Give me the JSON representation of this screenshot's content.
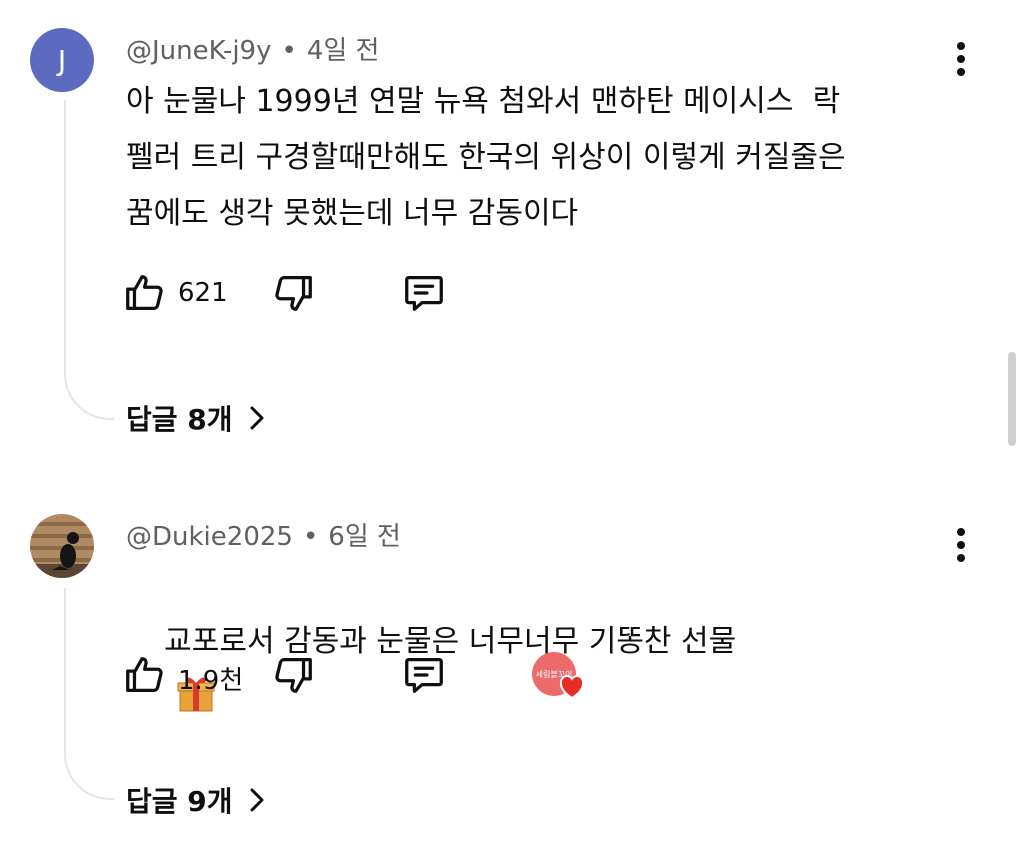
{
  "comments": [
    {
      "avatar_letter": "J",
      "author": "@JuneK-j9y",
      "time": "4일 전",
      "text": "아 눈물나 1999년 연말 뉴욕 첨와서 맨하탄 메이시스  락\n펠러 트리 구경할때만해도 한국의 위상이 이렇게 커질줄은\n꿈에도 생각 못했는데 너무 감동이다",
      "like_count": "621",
      "replies_label": "답글 8개"
    },
    {
      "author": "@Dukie2025",
      "time": "6일 전",
      "text": "교포로서 감동과 눈물은 너무너무 기똥찬 선물",
      "like_count": "1.9천",
      "creator_avatar_text": "세림볼꼬이",
      "replies_label": "답글 9개"
    }
  ],
  "separator_dot": "•",
  "icons": {
    "like": "thumbs-up-icon",
    "dislike": "thumbs-down-icon",
    "reply": "reply-comment-icon",
    "more": "more-vertical-icon",
    "chevron": "chevron-right-icon",
    "gift": "gift-emoji-icon",
    "heart": "heart-icon"
  },
  "colors": {
    "avatar_bg": "#5c6bc0",
    "meta_text": "#606060",
    "heart": "#e52d27"
  }
}
